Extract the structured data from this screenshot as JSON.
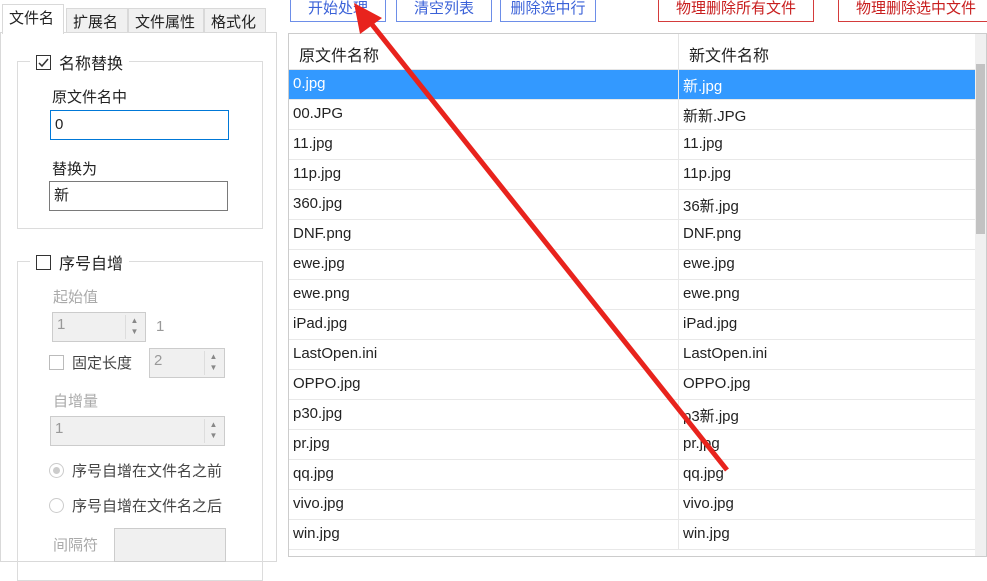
{
  "tabs": [
    "文件名",
    "扩展名",
    "文件属性",
    "格式化"
  ],
  "name_replace": {
    "title": "名称替换",
    "checked": true,
    "find_label": "原文件名中",
    "find_value": "0",
    "replace_label": "替换为",
    "replace_value": "新"
  },
  "seq": {
    "title": "序号自增",
    "checked": false,
    "start_label": "起始值",
    "start_value": "1",
    "start_preview": "1",
    "fixed_len_label": "固定长度",
    "fixed_len_value": "2",
    "inc_label": "自增量",
    "inc_value": "1",
    "before_label": "序号自增在文件名之前",
    "after_label": "序号自增在文件名之后",
    "sep_label": "间隔符"
  },
  "toolbar": {
    "start": "开始处理",
    "clear": "清空列表",
    "delete_row": "删除选中行",
    "del_all": "物理删除所有文件",
    "del_sel": "物理删除选中文件"
  },
  "table": {
    "headers": [
      "原文件名称",
      "新文件名称"
    ],
    "rows": [
      [
        "0.jpg",
        "新.jpg"
      ],
      [
        "00.JPG",
        "新新.JPG"
      ],
      [
        "11.jpg",
        "11.jpg"
      ],
      [
        "11p.jpg",
        "11p.jpg"
      ],
      [
        "360.jpg",
        "36新.jpg"
      ],
      [
        "DNF.png",
        "DNF.png"
      ],
      [
        "ewe.jpg",
        "ewe.jpg"
      ],
      [
        "ewe.png",
        "ewe.png"
      ],
      [
        "iPad.jpg",
        "iPad.jpg"
      ],
      [
        "LastOpen.ini",
        "LastOpen.ini"
      ],
      [
        "OPPO.jpg",
        "OPPO.jpg"
      ],
      [
        "p30.jpg",
        "p3新.jpg"
      ],
      [
        "pr.jpg",
        "pr.jpg"
      ],
      [
        "qq.jpg",
        "qq.jpg"
      ],
      [
        "vivo.jpg",
        "vivo.jpg"
      ],
      [
        "win.jpg",
        "win.jpg"
      ]
    ]
  },
  "arrow_color": "#e8231d"
}
